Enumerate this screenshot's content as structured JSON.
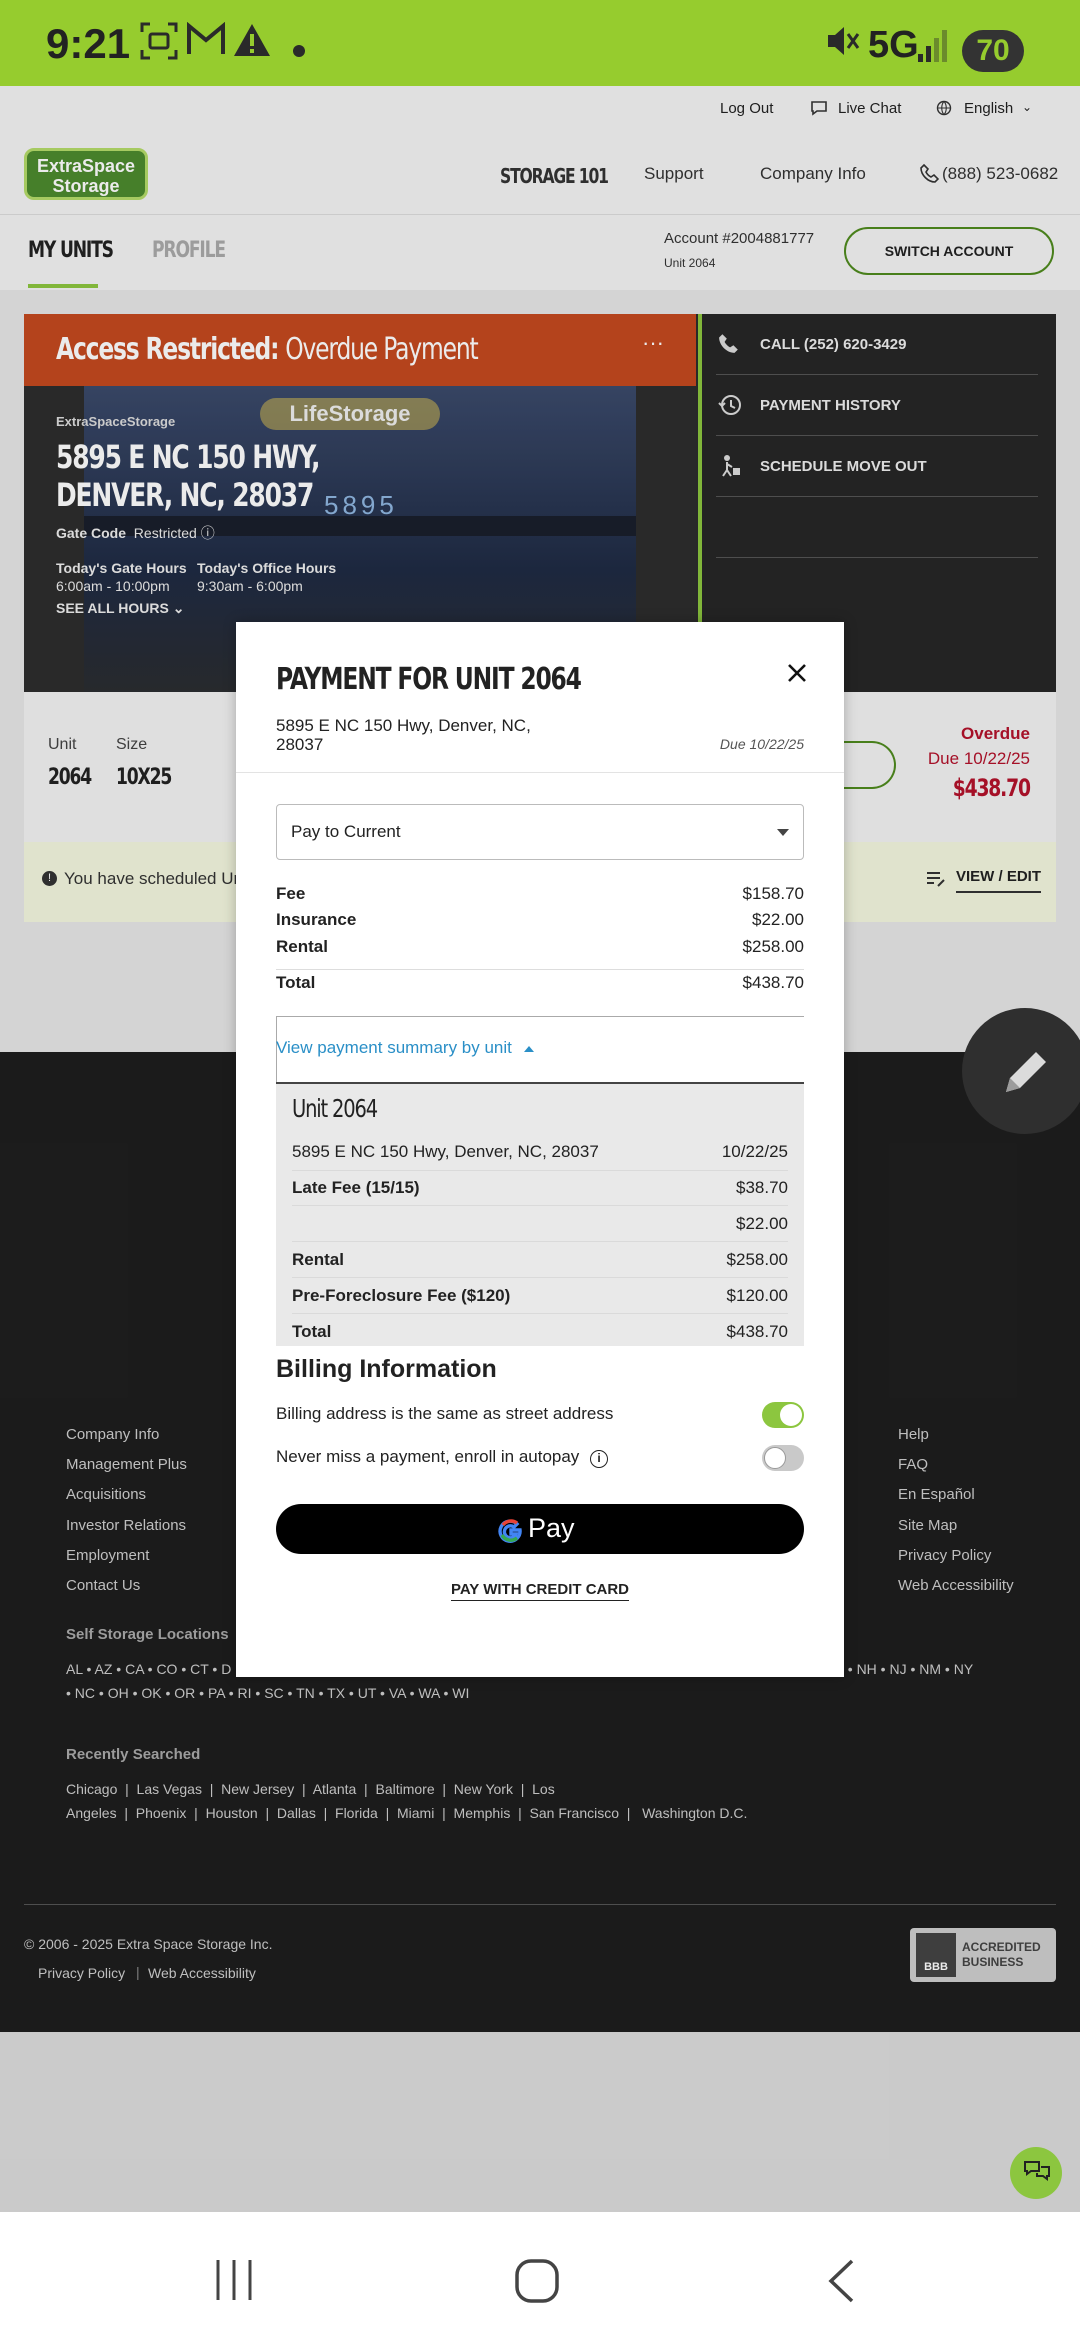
{
  "status": {
    "time": "9:21",
    "network": "5G",
    "battery": "70",
    "icons": [
      "screenshot-icon",
      "gmail-icon",
      "warning-icon",
      "dot-icon",
      "mute-icon",
      "signal-icon"
    ]
  },
  "topnav": {
    "logout": "Log Out",
    "live_chat": "Live Chat",
    "language": "English"
  },
  "header": {
    "logo_line1": "ExtraSpace",
    "logo_line2": "Storage",
    "storage101": "STORAGE 101",
    "support": "Support",
    "company_info": "Company Info",
    "phone": "(888) 523-0682"
  },
  "tabs": {
    "my_units": "MY UNITS",
    "profile": "PROFILE",
    "account": "Account #2004881777",
    "unit": "Unit 2064",
    "switch_account": "SWITCH ACCOUNT"
  },
  "card": {
    "banner_bold": "Access Restricted:",
    "banner_rest": "Overdue Payment",
    "brand": "ExtraSpaceStorage",
    "photo_sign": "LifeStorage",
    "photo_number": "5895",
    "address1": "5895 E NC 150 HWY,",
    "address2": "DENVER, NC, 28037",
    "gate_code_label": "Gate Code",
    "gate_code_value": "Restricted",
    "gate_hours_label": "Today's Gate Hours",
    "gate_hours": "6:00am - 10:00pm",
    "office_hours_label": "Today's Office Hours",
    "office_hours": "9:30am - 6:00pm",
    "see_all": "SEE ALL HOURS",
    "side": [
      "CALL (252) 620-3429",
      "PAYMENT HISTORY",
      "SCHEDULE MOVE OUT"
    ],
    "unit_label": "Unit",
    "unit_value": "2064",
    "size_label": "Size",
    "size_value": "10X25",
    "overdue": "Overdue",
    "due": "Due 10/22/25",
    "amount": "$438.70",
    "notice": "You have scheduled Un",
    "view_edit": "VIEW / EDIT"
  },
  "modal": {
    "title": "PAYMENT FOR UNIT 2064",
    "address_line1": "5895 E NC 150 Hwy, Denver, NC,",
    "address_line2": "28037",
    "due": "Due 10/22/25",
    "select_value": "Pay to Current",
    "lines": [
      {
        "label": "Fee",
        "value": "$158.70"
      },
      {
        "label": "Insurance",
        "value": "$22.00"
      },
      {
        "label": "Rental",
        "value": "$258.00"
      }
    ],
    "total_label": "Total",
    "total_value": "$438.70",
    "summary_link": "View payment summary by unit",
    "summary": {
      "unit": "Unit 2064",
      "address": "5895 E NC 150 Hwy, Denver, NC, 28037",
      "date": "10/22/25",
      "rows": [
        {
          "label": "Late Fee (15/15)",
          "value": "$38.70"
        },
        {
          "label": "",
          "value": "$22.00"
        },
        {
          "label": "Rental",
          "value": "$258.00"
        },
        {
          "label": "Pre-Foreclosure Fee ($120)",
          "value": "$120.00"
        },
        {
          "label": "Total",
          "value": "$438.70"
        }
      ]
    },
    "billing_title": "Billing Information",
    "billing_same": "Billing address is the same as street address",
    "autopay": "Never miss a payment, enroll in autopay",
    "gpay": "Pay",
    "credit_card": "PAY WITH CREDIT CARD"
  },
  "footer": {
    "col1": [
      "Company Info",
      "Management Plus",
      "Acquisitions",
      "Investor Relations",
      "Employment",
      "Contact Us"
    ],
    "col3": [
      "Help",
      "FAQ",
      "En Español",
      "Site Map",
      "Privacy Policy",
      "Web Accessibility"
    ],
    "locations_title": "Self Storage Locations",
    "states_line1": "AL • AZ • CA • CO • CT • D",
    "states_line1_right": "/ • NH • NJ • NM • NY",
    "states_line2": "• NC • OH • OK • OR • PA • RI • SC • TN • TX • UT • VA • WA • WI",
    "recent_title": "Recently Searched",
    "recent_line1": "Chicago  |  Las Vegas  |  New Jersey  |  Atlanta  |  Baltimore  |  New York  |  Los",
    "recent_line2": "Angeles  |  Phoenix  |  Houston  |  Dallas  |  Florida  |  Miami  |  Memphis  |  San Francisco  |   Washington D.C.",
    "copyright": "© 2006 - 2025 Extra Space Storage Inc.",
    "privacy": "Privacy Policy",
    "accessibility": "Web Accessibility",
    "bbb_line1": "ACCREDITED",
    "bbb_line2": "BUSINESS",
    "bbb": "BBB"
  },
  "colors": {
    "brand_green": "#96cc2e",
    "overdue_red": "#b3122b",
    "link_blue": "#2a8fc7"
  }
}
